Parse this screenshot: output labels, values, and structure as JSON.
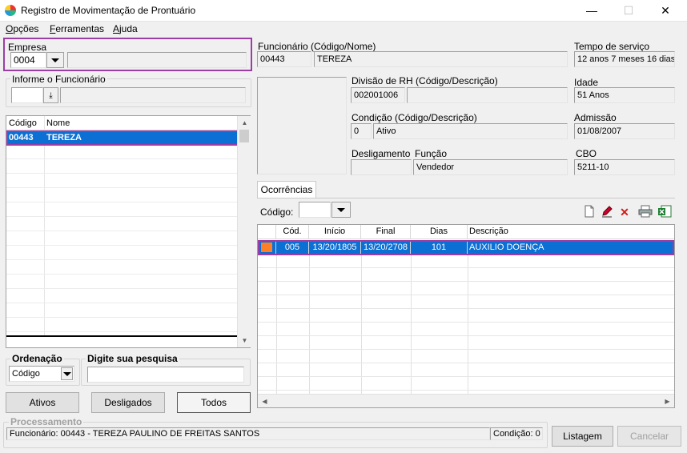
{
  "window": {
    "title": "Registro de Movimentação de Prontuário"
  },
  "menu": {
    "items": [
      {
        "label": "Opções",
        "u": "O"
      },
      {
        "label": "Ferramentas",
        "u": "F"
      },
      {
        "label": "Ajuda",
        "u": "A"
      }
    ]
  },
  "empresa": {
    "label": "Empresa",
    "code": "0004",
    "name": ""
  },
  "informe": {
    "label": "Informe o Funcionário",
    "value": ""
  },
  "employee_list": {
    "columns": [
      "Código",
      "Nome"
    ],
    "rows": [
      {
        "codigo": "00443",
        "nome": "TEREZA"
      }
    ]
  },
  "ordenacao": {
    "label": "Ordenação",
    "value": "Código"
  },
  "pesquisa": {
    "label": "Digite sua pesquisa",
    "value": ""
  },
  "filter_buttons": {
    "ativos": "Ativos",
    "desligados": "Desligados",
    "todos": "Todos"
  },
  "funcionario": {
    "label": "Funcionário (Código/Nome)",
    "codigo": "00443",
    "nome": "TEREZA"
  },
  "tempo_servico": {
    "label": "Tempo de serviço",
    "value": "12 anos 7 meses 16 dias"
  },
  "divisao": {
    "label": "Divisão de RH (Código/Descrição)",
    "codigo": "002001006",
    "descricao": ""
  },
  "idade": {
    "label": "Idade",
    "value": "51 Anos"
  },
  "condicao": {
    "label": "Condição (Código/Descrição)",
    "codigo": "0",
    "descricao": "Ativo"
  },
  "admissao": {
    "label": "Admissão",
    "value": "01/08/2007"
  },
  "desligamento": {
    "label": "Desligamento",
    "value": ""
  },
  "funcao": {
    "label": "Função",
    "value": "Vendedor"
  },
  "cbo": {
    "label": "CBO",
    "value": "5211-10"
  },
  "tabs": {
    "ocorrencias": "Ocorrências"
  },
  "ocorrencias": {
    "codigo_label": "Código:",
    "codigo_value": "",
    "columns": [
      "Cód.",
      "Início",
      "Final",
      "Dias",
      "Descrição"
    ],
    "rows": [
      {
        "cod": "005",
        "inicio": "13/20/1805",
        "final": "13/20/2708",
        "dias": "101",
        "descricao": "AUXILIO DOENÇA",
        "color": "#ff7f27"
      }
    ]
  },
  "processamento": {
    "label": "Processamento",
    "status": "Funcionário: 00443 - TEREZA PAULINO DE FREITAS SANTOS",
    "condicao": "Condição: 0"
  },
  "bottom_buttons": {
    "listagem": "Listagem",
    "cancelar": "Cancelar"
  }
}
